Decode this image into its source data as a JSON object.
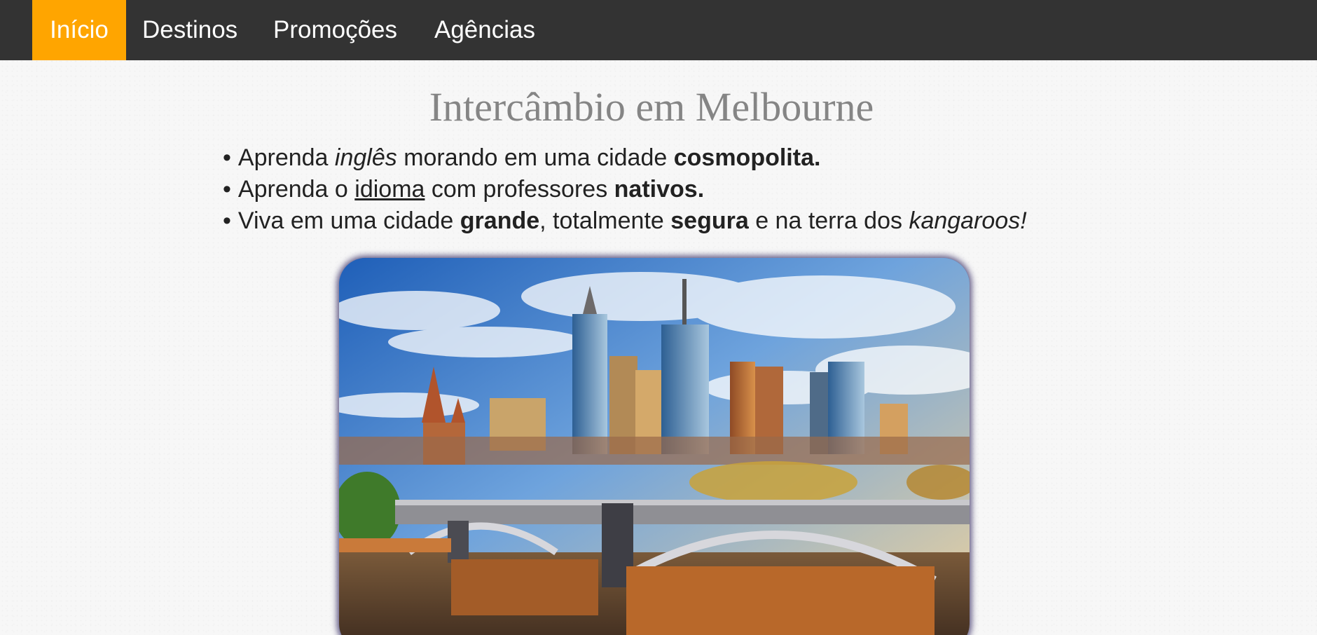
{
  "nav": {
    "items": [
      {
        "label": "Início",
        "active": true
      },
      {
        "label": "Destinos",
        "active": false
      },
      {
        "label": "Promoções",
        "active": false
      },
      {
        "label": "Agências",
        "active": false
      }
    ],
    "background_color": "#333333",
    "active_color": "#ffa500"
  },
  "main": {
    "title": "Intercâmbio em Melbourne",
    "features": [
      {
        "bullet": "•",
        "parts": [
          "Aprenda ",
          "inglês",
          " morando em uma cidade ",
          "cosmopolita."
        ]
      },
      {
        "bullet": "•",
        "parts": [
          "Aprenda o ",
          "idioma",
          " com professores ",
          "nativos."
        ]
      },
      {
        "bullet": "•",
        "parts": [
          "Viva em uma cidade ",
          "grande",
          ", totalmente ",
          "segura",
          " e na terra dos ",
          "kangaroos!"
        ]
      }
    ],
    "photo": {
      "subject": "Melbourne skyline with Princes Bridge over the Yarra River",
      "icon": "city-photo"
    }
  }
}
